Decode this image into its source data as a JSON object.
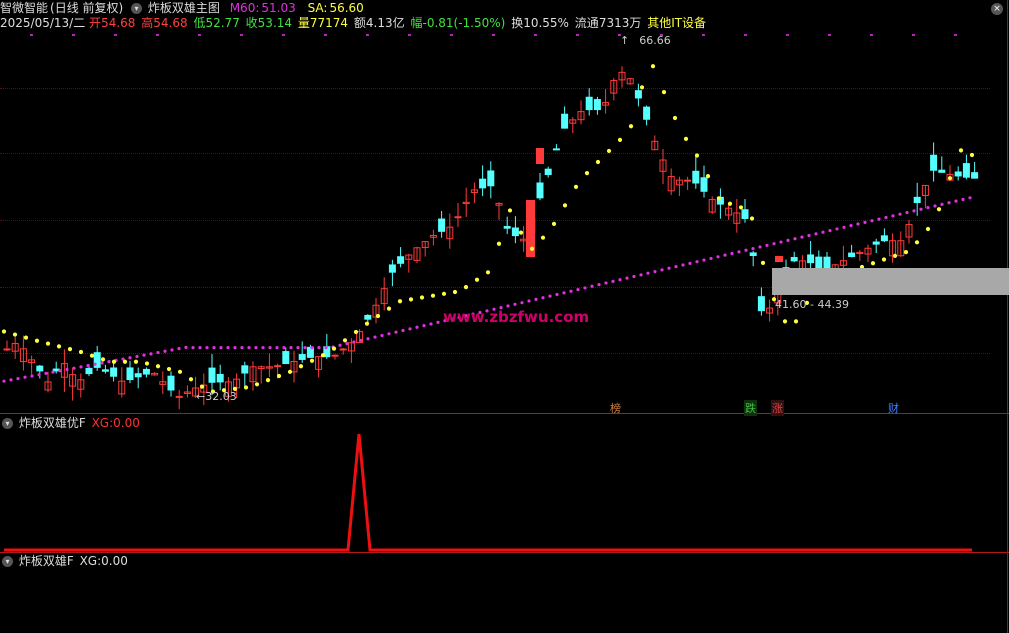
{
  "app": {
    "title": "智微智能",
    "period": "(日线 前复权)"
  },
  "main": {
    "indicator_name": "炸板双雄主图",
    "m60_label": "M60:",
    "m60_value": "51.03",
    "sa_label": "SA:",
    "sa_value": "56.60",
    "date": "2025/05/13/二",
    "open_label": "开",
    "open": "54.68",
    "high_label": "高",
    "high": "54.68",
    "low_label": "低",
    "low": "52.77",
    "close_label": "收",
    "close": "53.14",
    "vol_label": "量",
    "vol": "77174",
    "amt_label": "额",
    "amt": "4.13亿",
    "chg_label": "幅",
    "chg": "-0.81(-1.50%)",
    "turnover_label": "换",
    "turnover": "10.55%",
    "float_label": "流通",
    "float": "7313万",
    "sector": "其他IT设备",
    "high_mark": "66.66",
    "low_mark": "32.03",
    "range_text": "41.60 - 44.39",
    "watermark": "www.zbzfwu.com",
    "events": [
      {
        "text": "榜",
        "color": "#d08040"
      },
      {
        "text": "跌",
        "color": "#40c040"
      },
      {
        "text": "涨",
        "color": "#e04040"
      },
      {
        "text": "财",
        "color": "#4080ff"
      }
    ]
  },
  "panel2": {
    "name": "炸板双雄优F",
    "xg_label": "XG:",
    "xg_value": "0.00"
  },
  "panel3": {
    "name": "炸板双雄F",
    "xg_label": "XG:",
    "xg_value": "0.00"
  },
  "colors": {
    "up": "#ff3a3a",
    "down": "#54ffff",
    "m60": "#e030e0",
    "sa": "#ffff40",
    "signal": "#ee1010"
  }
}
